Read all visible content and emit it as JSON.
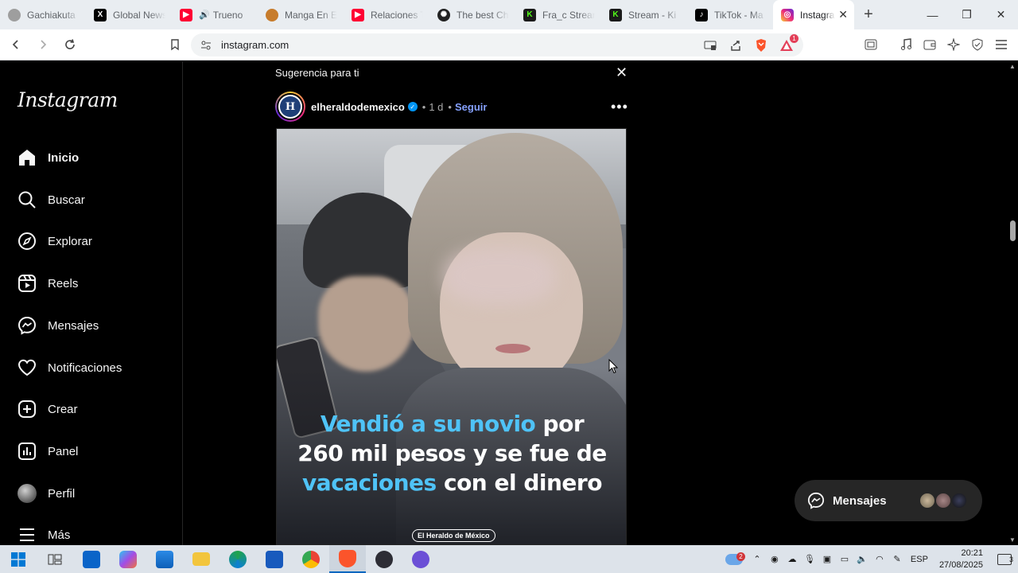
{
  "browser": {
    "tabs": [
      {
        "label": "Gachiakuta",
        "favicon": "gachiakuta-icon",
        "color": "#9e9e9e"
      },
      {
        "label": "Global News",
        "favicon": "x-icon",
        "color": "#000000"
      },
      {
        "label": "Trueno",
        "favicon": "youtube-icon",
        "color": "#ff0033"
      },
      {
        "label": "Manga En E",
        "favicon": "manga-icon",
        "color": "#c77c2c"
      },
      {
        "label": "Relaciones T",
        "favicon": "youtube-icon",
        "color": "#ff0033"
      },
      {
        "label": "The best Ch",
        "favicon": "chatgpt-icon",
        "color": "#000000"
      },
      {
        "label": "Fra_c Stream",
        "favicon": "kick-icon",
        "color": "#53fc18"
      },
      {
        "label": "Stream - Ki",
        "favicon": "kick-icon",
        "color": "#53fc18"
      },
      {
        "label": "TikTok - Ma",
        "favicon": "tiktok-icon",
        "color": "#000000"
      },
      {
        "label": "Instagram",
        "favicon": "instagram-icon",
        "color": "#e1306c",
        "active": true
      }
    ],
    "url": "instagram.com",
    "brave_badge": "1"
  },
  "sidebar": {
    "logo": "Instagram",
    "items": [
      {
        "label": "Inicio",
        "icon": "home-icon"
      },
      {
        "label": "Buscar",
        "icon": "search-icon"
      },
      {
        "label": "Explorar",
        "icon": "compass-icon"
      },
      {
        "label": "Reels",
        "icon": "reels-icon"
      },
      {
        "label": "Mensajes",
        "icon": "messenger-icon"
      },
      {
        "label": "Notificaciones",
        "icon": "heart-icon"
      },
      {
        "label": "Crear",
        "icon": "plus-square-icon"
      },
      {
        "label": "Panel",
        "icon": "dashboard-icon"
      },
      {
        "label": "Perfil",
        "icon": "profile-avatar"
      },
      {
        "label": "Más",
        "icon": "menu-icon"
      }
    ]
  },
  "post": {
    "suggestion_label": "Sugerencia para ti",
    "username": "elheraldodemexico",
    "avatar_letter": "H",
    "time": "1 d",
    "follow_label": "Seguir",
    "caption_parts": [
      {
        "text": "Vendió a su novio",
        "highlight": true
      },
      {
        "text": " por",
        "highlight": false
      },
      {
        "text": "260 mil pesos y se fue de",
        "highlight": false
      },
      {
        "text": "vacaciones",
        "highlight": true
      },
      {
        "text": " con el dinero",
        "highlight": false
      }
    ],
    "brand_tag": "El Heraldo de México"
  },
  "messages_pill": {
    "label": "Mensajes"
  },
  "taskbar": {
    "weather_badge": "2",
    "language": "ESP",
    "time": "20:21",
    "date": "27/08/2025",
    "notifications": "3"
  },
  "colors": {
    "accent_link": "#85a1ff",
    "verified": "#0095f6",
    "caption_highlight": "#4fc3f7"
  }
}
